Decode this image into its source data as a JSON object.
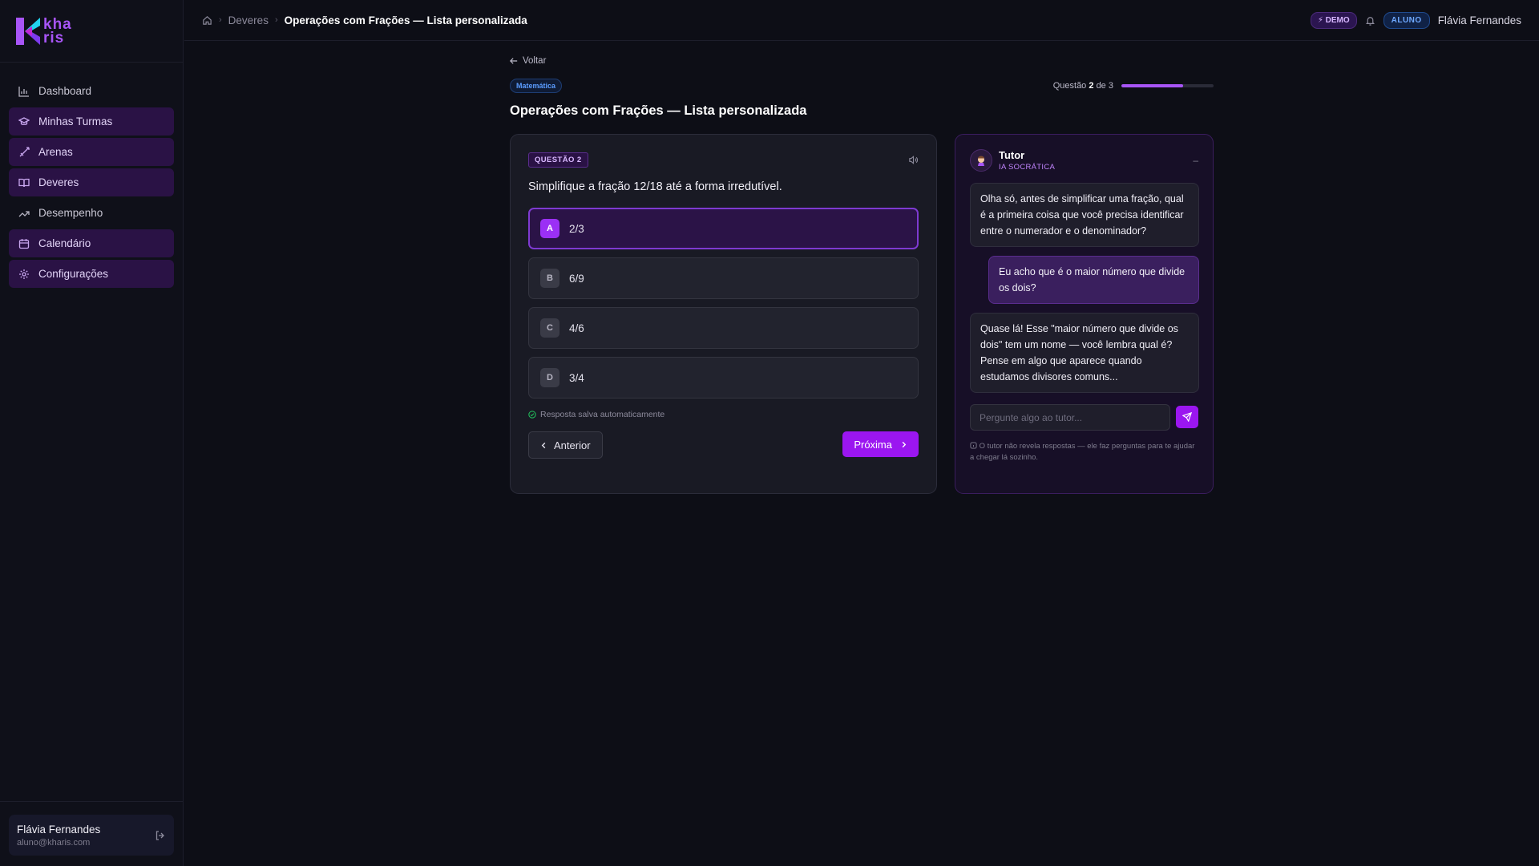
{
  "brand": {
    "logo_text_line1": "kha",
    "logo_text_line2": "ris",
    "accent": "#a855f7"
  },
  "sidebar": {
    "items": [
      {
        "label": "Dashboard",
        "icon": "bar-chart-icon",
        "active": false
      },
      {
        "label": "Minhas Turmas",
        "icon": "graduation-cap-icon",
        "active": true
      },
      {
        "label": "Arenas",
        "icon": "sword-icon",
        "active": true
      },
      {
        "label": "Deveres",
        "icon": "book-open-icon",
        "active": true
      },
      {
        "label": "Desempenho",
        "icon": "trending-up-icon",
        "active": false
      },
      {
        "label": "Calendário",
        "icon": "calendar-icon",
        "active": true
      },
      {
        "label": "Configurações",
        "icon": "settings-icon",
        "active": true
      }
    ],
    "user": {
      "name": "Flávia Fernandes",
      "email": "aluno@kharis.com"
    }
  },
  "topbar": {
    "breadcrumb": {
      "parent": "Deveres",
      "current": "Operações com Frações — Lista personalizada"
    },
    "demo_badge": "DEMO",
    "role_badge": "ALUNO",
    "user_name": "Flávia Fernandes"
  },
  "main": {
    "back_label": "Voltar",
    "subject": "Matemática",
    "progress": {
      "prefix": "Questão",
      "current": "2",
      "of": "de",
      "total": "3",
      "fraction": 0.667
    },
    "title": "Operações com Frações — Lista personalizada",
    "question": {
      "badge": "QUESTÃO 2",
      "text": "Simplifique a fração 12/18 até a forma irredutível.",
      "options": [
        {
          "letter": "A",
          "value": "2/3",
          "selected": true
        },
        {
          "letter": "B",
          "value": "6/9",
          "selected": false
        },
        {
          "letter": "C",
          "value": "4/6",
          "selected": false
        },
        {
          "letter": "D",
          "value": "3/4",
          "selected": false
        }
      ],
      "saved_text": "Resposta salva automaticamente",
      "prev_label": "Anterior",
      "next_label": "Próxima"
    },
    "tutor": {
      "name": "Tutor",
      "role": "IA SOCRÁTICA",
      "minimize": "–",
      "messages": [
        {
          "from": "tutor",
          "text": "Olha só, antes de simplificar uma fração, qual é a primeira coisa que você precisa identificar entre o numerador e o denominador?"
        },
        {
          "from": "user",
          "text": "Eu acho que é o maior número que divide os dois?"
        },
        {
          "from": "tutor",
          "text": "Quase lá! Esse \"maior número que divide os dois\" tem um nome — você lembra qual é? Pense em algo que aparece quando estudamos divisores comuns..."
        }
      ],
      "input_placeholder": "Pergunte algo ao tutor...",
      "note": "O tutor não revela respostas — ele faz perguntas para te ajudar a chegar lá sozinho."
    }
  }
}
